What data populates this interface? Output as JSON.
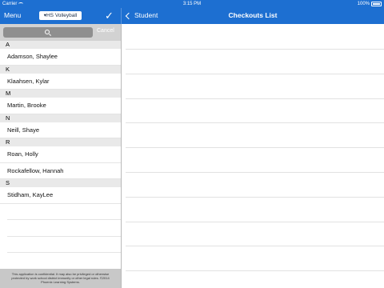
{
  "status_bar": {
    "carrier": "Carrier",
    "time": "3:15 PM",
    "battery": "100%"
  },
  "nav_left": {
    "menu_label": "Menu",
    "team_selector": "▾HS Volleyball",
    "done_icon": "checkmark-icon"
  },
  "nav_right": {
    "back_label": "Student",
    "title": "Checkouts List"
  },
  "search": {
    "placeholder": "",
    "cancel_label": "Cancel"
  },
  "roster": [
    {
      "letter": "A",
      "students": [
        "Adamson, Shaylee"
      ]
    },
    {
      "letter": "K",
      "students": [
        "Klaahsen, Kylar"
      ]
    },
    {
      "letter": "M",
      "students": [
        "Martin, Brooke"
      ]
    },
    {
      "letter": "N",
      "students": [
        "Neill, Shaye"
      ]
    },
    {
      "letter": "R",
      "students": [
        "Roan, Holly",
        "Rockafellow, Hannah"
      ]
    },
    {
      "letter": "S",
      "students": [
        "Stidham, KayLee"
      ]
    }
  ],
  "footer": {
    "line1": "This application is confidential. It may also be privileged or otherwise",
    "line2": "protected by work school district immunity or other legal rules. ©2014",
    "line3": "Phoenix Learning Systems."
  },
  "colors": {
    "brand_blue": "#1d6fd1",
    "section_header": "#e9e9e9",
    "search_bar": "#d2d2d2"
  }
}
